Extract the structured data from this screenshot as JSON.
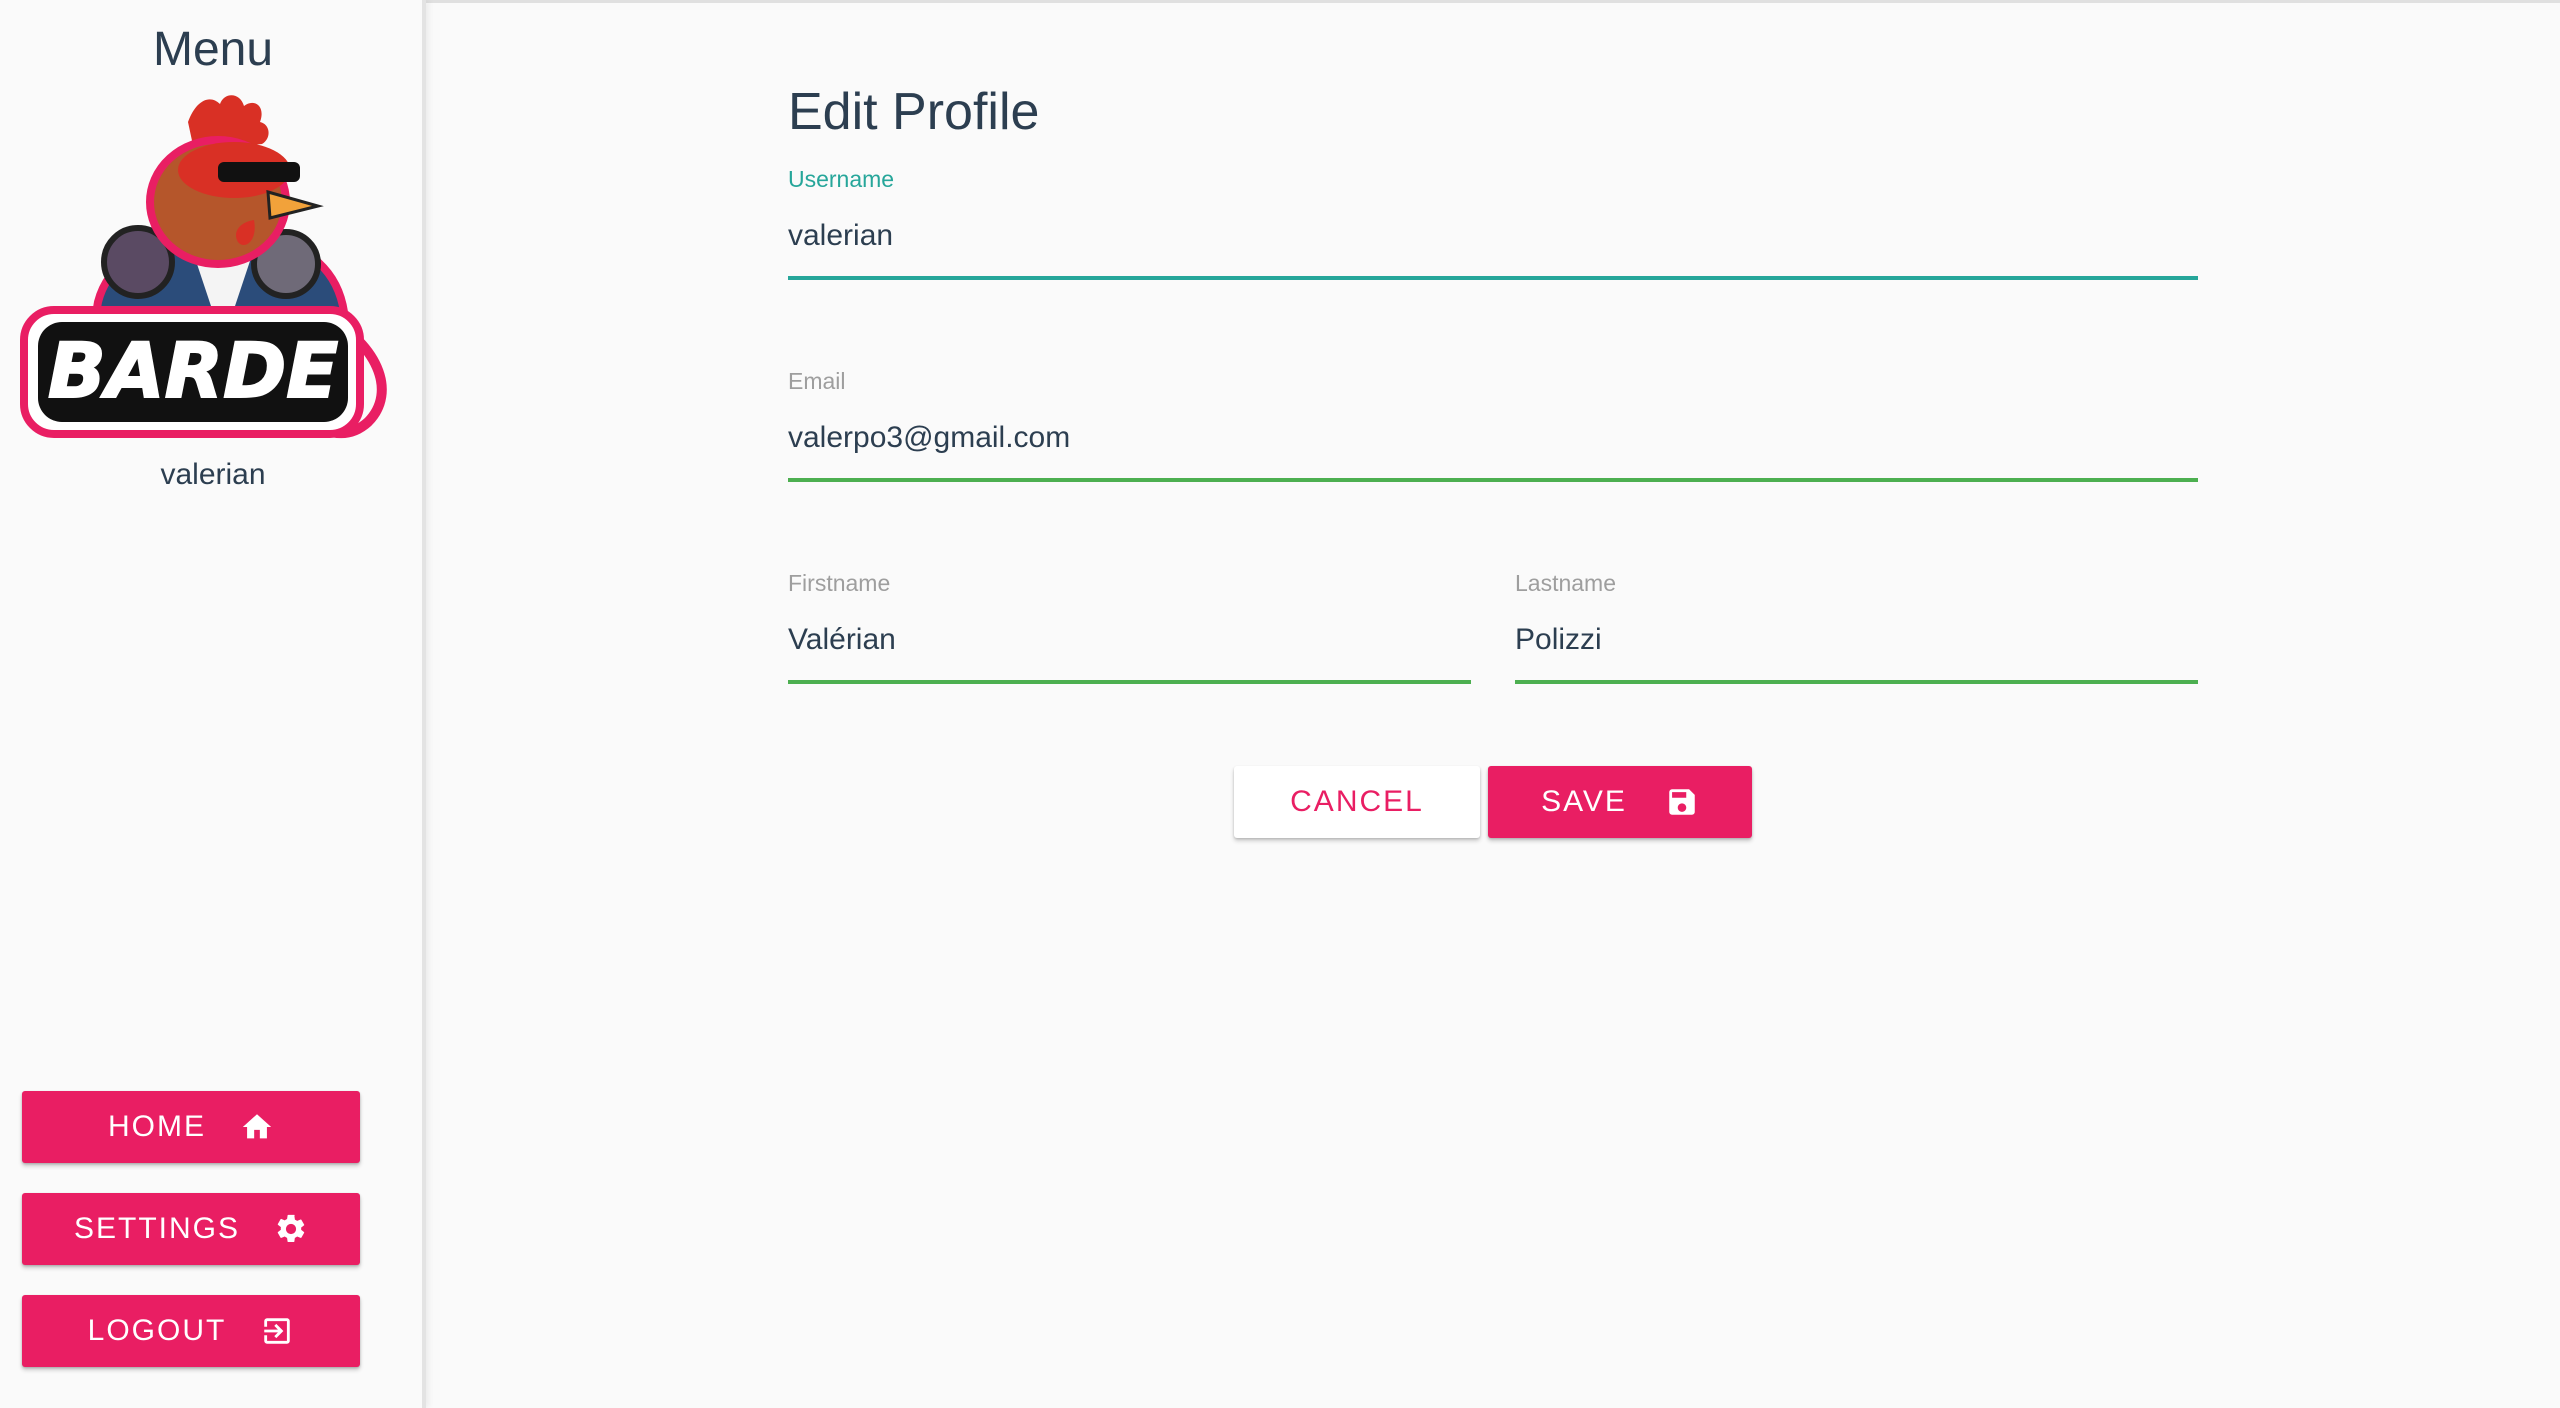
{
  "sidebar": {
    "title": "Menu",
    "logo_text": "BARDE",
    "username": "valerian",
    "nav": {
      "home_label": "HOME",
      "settings_label": "SETTINGS",
      "logout_label": "LOGOUT"
    },
    "icons": {
      "home": "home-icon",
      "settings": "gear-icon",
      "logout": "logout-icon"
    }
  },
  "main": {
    "title": "Edit Profile",
    "fields": {
      "username": {
        "label": "Username",
        "value": "valerian"
      },
      "email": {
        "label": "Email",
        "value": "valerpo3@gmail.com"
      },
      "firstname": {
        "label": "Firstname",
        "value": "Valérian"
      },
      "lastname": {
        "label": "Lastname",
        "value": "Polizzi"
      }
    },
    "actions": {
      "cancel_label": "CANCEL",
      "save_label": "SAVE",
      "save_icon": "floppy-disk-icon"
    }
  },
  "colors": {
    "accent": "#e91e63",
    "focused_underline": "#26a69a",
    "valid_underline": "#4caf50",
    "text": "#2c3e50"
  }
}
